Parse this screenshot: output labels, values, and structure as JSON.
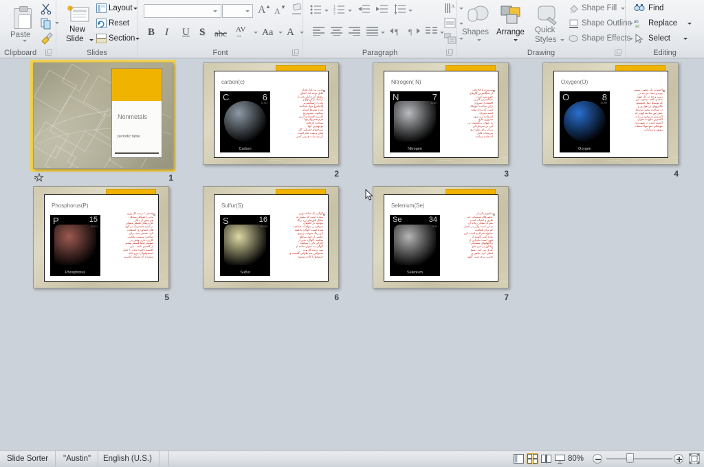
{
  "app": {
    "view_name": "Slide Sorter",
    "theme_name": "\"Austin\"",
    "language": "English (U.S.)",
    "zoom_level": "80%"
  },
  "ribbon": {
    "groups": [
      {
        "name": "Clipboard",
        "label": "Clipboard"
      },
      {
        "name": "Slides",
        "label": "Slides"
      },
      {
        "name": "Font",
        "label": "Font"
      },
      {
        "name": "Paragraph",
        "label": "Paragraph"
      },
      {
        "name": "Drawing",
        "label": "Drawing"
      },
      {
        "name": "Editing",
        "label": "Editing"
      }
    ],
    "clipboard": {
      "paste": "Paste",
      "cut_icon": "scissors-icon",
      "copy_icon": "copy-icon",
      "format_painter_icon": "format-painter-icon"
    },
    "slides": {
      "new_slide_line1": "New",
      "new_slide_line2": "Slide",
      "layout": "Layout",
      "reset": "Reset",
      "section": "Section"
    },
    "font": {
      "font_name_value": "",
      "font_name_placeholder": "",
      "font_size_value": "",
      "grow_font": "A",
      "shrink_font": "A",
      "clear_formatting_icon": "clear-formatting-icon",
      "bold": "B",
      "italic": "I",
      "underline": "U",
      "shadow": "S",
      "strikethrough": "abc",
      "character_spacing": "AV",
      "change_case": "Aa",
      "font_color": "A"
    },
    "paragraph": {
      "bullets_icon": "bullets-icon",
      "numbering_icon": "numbering-icon",
      "decrease_indent_icon": "decrease-indent-icon",
      "increase_indent_icon": "increase-indent-icon",
      "line_spacing_icon": "line-spacing-icon",
      "text_direction_icon": "text-direction-icon",
      "align_text_icon": "align-text-icon",
      "convert_smartart_icon": "convert-to-smartart-icon",
      "align_left_icon": "align-left-icon",
      "align_center_icon": "align-center-icon",
      "align_right_icon": "align-right-icon",
      "justify_icon": "justify-icon",
      "ltr_icon": "left-to-right-icon",
      "rtl_icon": "right-to-left-icon",
      "columns_icon": "columns-icon"
    },
    "drawing": {
      "shapes": "Shapes",
      "arrange": "Arrange",
      "quick_styles_line1": "Quick",
      "quick_styles_line2": "Styles",
      "shape_fill": "Shape Fill",
      "shape_outline": "Shape Outline",
      "shape_effects": "Shape Effects"
    },
    "editing": {
      "find": "Find",
      "replace": "Replace",
      "select": "Select"
    }
  },
  "slides": [
    {
      "number": "1",
      "kind": "title",
      "selected": true,
      "has_transition_star": true,
      "title": "Nonmetals",
      "subtitle": "periodic table"
    },
    {
      "number": "2",
      "kind": "element",
      "selected": false,
      "has_transition_star": false,
      "title": "carbon(c)",
      "symbol": "C",
      "atomic_number": "6",
      "atomic_mass": "12.011",
      "caption": "Carbon",
      "swatch": "#8e9aa6",
      "body_lines": [
        "کربن به دلیل تعداد",
        "قابل توجه اند. اتفاق",
        "معتقد آن عامل بخی از",
        "ترکیبات [کربنها] و",
        "بخی از سنگینترین",
        "[الماس] مواد شناخته",
        "شده توسط انسان",
        "میباشد. معدوتریج",
        "کاربرد اقتصادی کربن",
        "فرم هیدروکربنها",
        "میباشد که قابل",
        "توجهترین آنها",
        "سوختهای فسیلی، گاز",
        "متان و نفت خام است.",
        "کربنیددمات فرمی کمتر"
      ]
    },
    {
      "number": "3",
      "kind": "element",
      "selected": false,
      "has_transition_star": false,
      "title": "Nitrogen( N)",
      "symbol": "N",
      "atomic_number": "7",
      "atomic_mass": "14.007",
      "caption": "Nitrogen",
      "swatch": "#b9bcc0",
      "body_lines": [
        "نیتروژن با ۷۸ بخی",
        "از سنگینترین گازهای",
        "جو زمین است .",
        "سنگینترین کاربرد",
        "اقتصادی نیتروژن",
        "برای ساخت آمونیاک",
        "است که برای تولید",
        "اسید نیتریک",
        "استفاده می شود.",
        "نیتروژن مایع",
        "به عنوان برگشتنده بی",
        "اثر، در سرمازدای",
        "یزیک برای تغلید ازی",
        "مرتبحات قابل",
        "استفاده میباشد"
      ]
    },
    {
      "number": "4",
      "kind": "element",
      "selected": false,
      "has_transition_star": false,
      "title": "Oxygen(O)",
      "symbol": "O",
      "atomic_number": "8",
      "atomic_mass": "15.999",
      "caption": "Oxygen",
      "swatch": "#2a6fd1",
      "body_lines": [
        "اکسیژن یک عنصر زیستی",
        "بوده و معدا جز چه در",
        "زمین و چه در کل جهان",
        "منشی یافته میشود. این",
        "که توسط عمل فتوسنتز",
        "باکتریهای بی هوازی و",
        "در سیاحت بیضی توسط",
        "عمل نور ساخته کهده اند",
        "اکسیژن به وجود می آید .",
        "اکسیژن مایع به عنوان",
        "اکسید کننده در شهروری",
        "موشکی سوختها استفاده",
        "موتور و بیمارانی"
      ]
    },
    {
      "number": "5",
      "kind": "element",
      "selected": false,
      "has_transition_star": false,
      "title": "Phosphorus(P)",
      "symbol": "P",
      "atomic_number": "15",
      "atomic_mass": "30.974",
      "caption": "Phosphorus",
      "swatch": "#9d5a52",
      "body_lines": [
        "فسفر ۱ درصد کل وزن",
        "بدن را تشکیل میدهد .",
        "هم چنین از دیگر",
        "کاربردهای فسفر میتوان",
        "در اسید فسفریک در کوه",
        "های کشاورزی استفاده",
        "کرد. فسفر مثبه برای",
        "ساختن سیمنت نظامی",
        "کاربرد دارد. وقتی در",
        "سهمتر شما فسفر بیشتر",
        "از کلسیم باشد . بدن",
        "کلسیم ذخیره شده را حمل",
        "استخوانها را بیرو انکه",
        "میشدند که تشکیل کلسیم"
      ]
    },
    {
      "number": "6",
      "kind": "element",
      "selected": false,
      "has_transition_star": false,
      "title": "Sulfur(S)",
      "symbol": "S",
      "atomic_number": "16",
      "atomic_mass": "32.065",
      "caption": "Sulfur",
      "swatch": "#ded9a4",
      "body_lines": [
        "گوگرد یک شاغد بویی.",
        "بیمزه است که بیشتر به",
        "شکل بلورهای زرد رنگ",
        "موجود در کانیهای",
        "سولفید و سولفات شناخته",
        "شده است. گوگرد با همه",
        "آبی رنگ سوخت و بوی",
        "عجیبی از خود ساطع",
        "میکنند . گوگرد بخی از",
        "اجزای باارزد میباشد .",
        "گوگرد به عنوان ساده از",
        "بهن برنده کاربو و",
        "سموکین شد طوانی گشتده و",
        "خروجها یا کادم میشود"
      ]
    },
    {
      "number": "7",
      "kind": "element",
      "selected": false,
      "has_transition_star": false,
      "title": "Selenium(Se)",
      "symbol": "Se",
      "atomic_number": "34",
      "atomic_mass": "78.96",
      "caption": "Selenium",
      "swatch": "#b5b5b5",
      "body_lines": [
        "سلنیوم یکی از",
        "عنصرهای شیمیایی غیر",
        "فلزی و کمیاب است.",
        "معرف مقدار زیاده آن",
        "سمی است ولی در مقدار",
        "کم برای فعالیت",
        "متابولیسم لازم است. این",
        "ماده آنتی اکسید از",
        "قوی است بنابراین از",
        "و التهابهای شیمیایی",
        "زیانآور در بدن جلو",
        "گیری می کند . منبع",
        "اصلی کرد، ماهی و",
        "تخمی مرغ، شیر، گلهن"
      ]
    }
  ],
  "statusbar": {
    "view_buttons": [
      {
        "name": "normal-view",
        "active": false
      },
      {
        "name": "slide-sorter-view",
        "active": true
      },
      {
        "name": "reading-view",
        "active": false
      },
      {
        "name": "slide-show-view",
        "active": false
      }
    ],
    "zoom_out_label": "−",
    "zoom_in_label": "+",
    "fit_to_window_name": "fit-slide-to-window-button"
  }
}
